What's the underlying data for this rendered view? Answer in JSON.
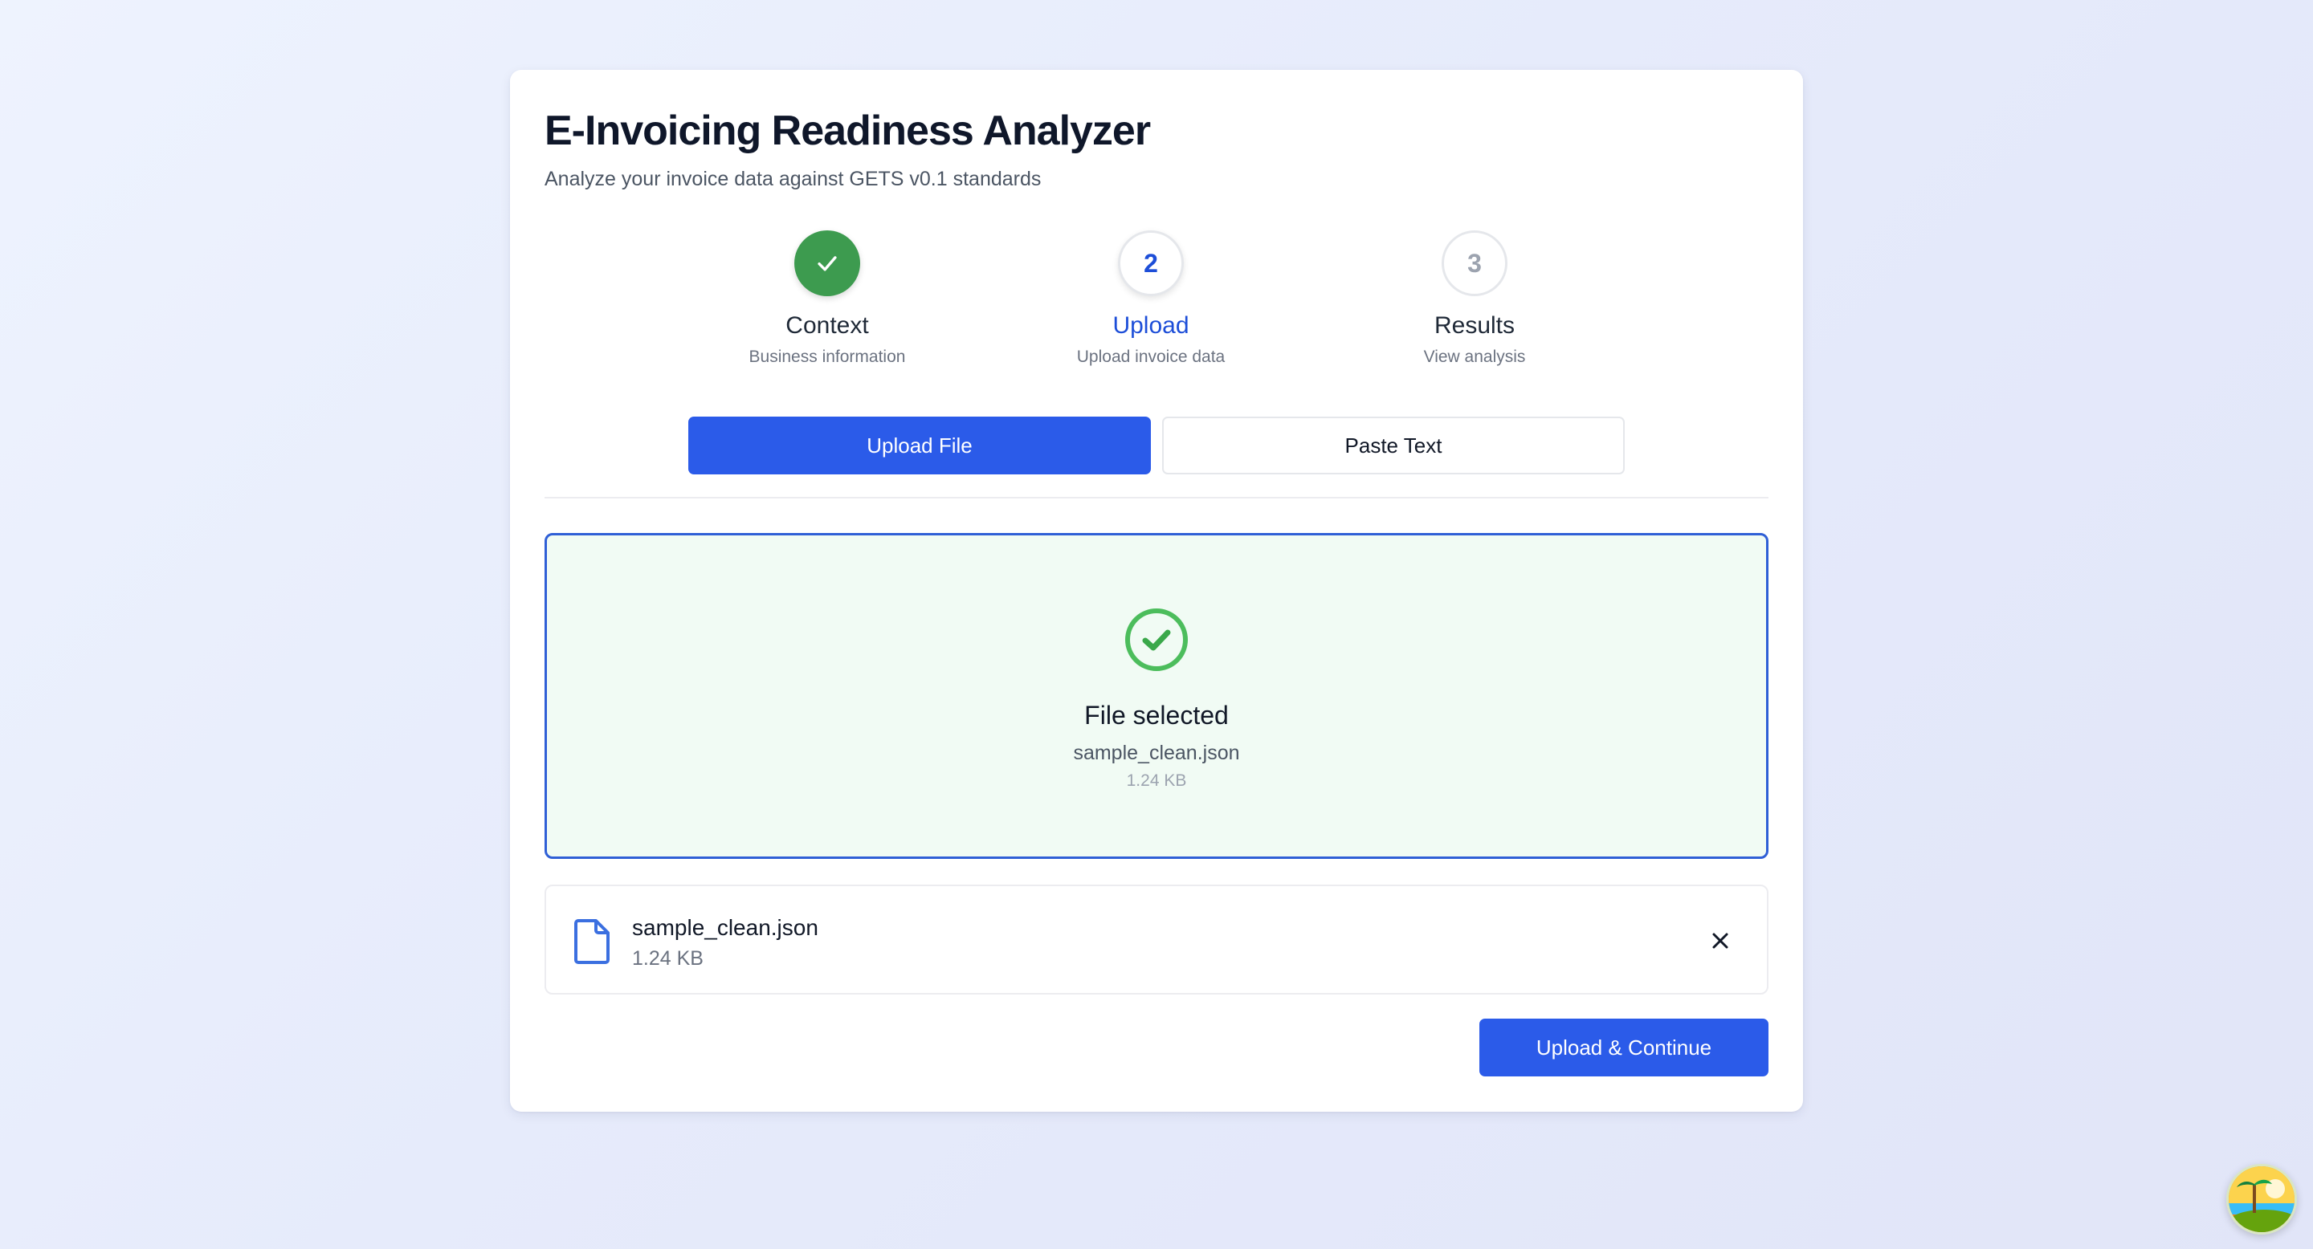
{
  "header": {
    "title": "E-Invoicing Readiness Analyzer",
    "subtitle": "Analyze your invoice data against GETS v0.1 standards"
  },
  "steps": [
    {
      "number": "1",
      "label": "Context",
      "description": "Business information",
      "state": "done"
    },
    {
      "number": "2",
      "label": "Upload",
      "description": "Upload invoice data",
      "state": "active"
    },
    {
      "number": "3",
      "label": "Results",
      "description": "View analysis",
      "state": "pending"
    }
  ],
  "tabs": {
    "upload_file": "Upload File",
    "paste_text": "Paste Text"
  },
  "dropzone": {
    "title": "File selected",
    "file_name": "sample_clean.json",
    "file_size": "1.24 KB"
  },
  "selected_file": {
    "name": "sample_clean.json",
    "size": "1.24 KB"
  },
  "actions": {
    "continue_label": "Upload & Continue"
  },
  "colors": {
    "primary": "#2b5be9",
    "success": "#3d9b4f",
    "dropzone_bg": "#f1fbf4"
  },
  "icons": {
    "step1": "check-icon",
    "dropzone": "check-circle-icon",
    "file": "file-icon",
    "remove": "close-icon"
  }
}
